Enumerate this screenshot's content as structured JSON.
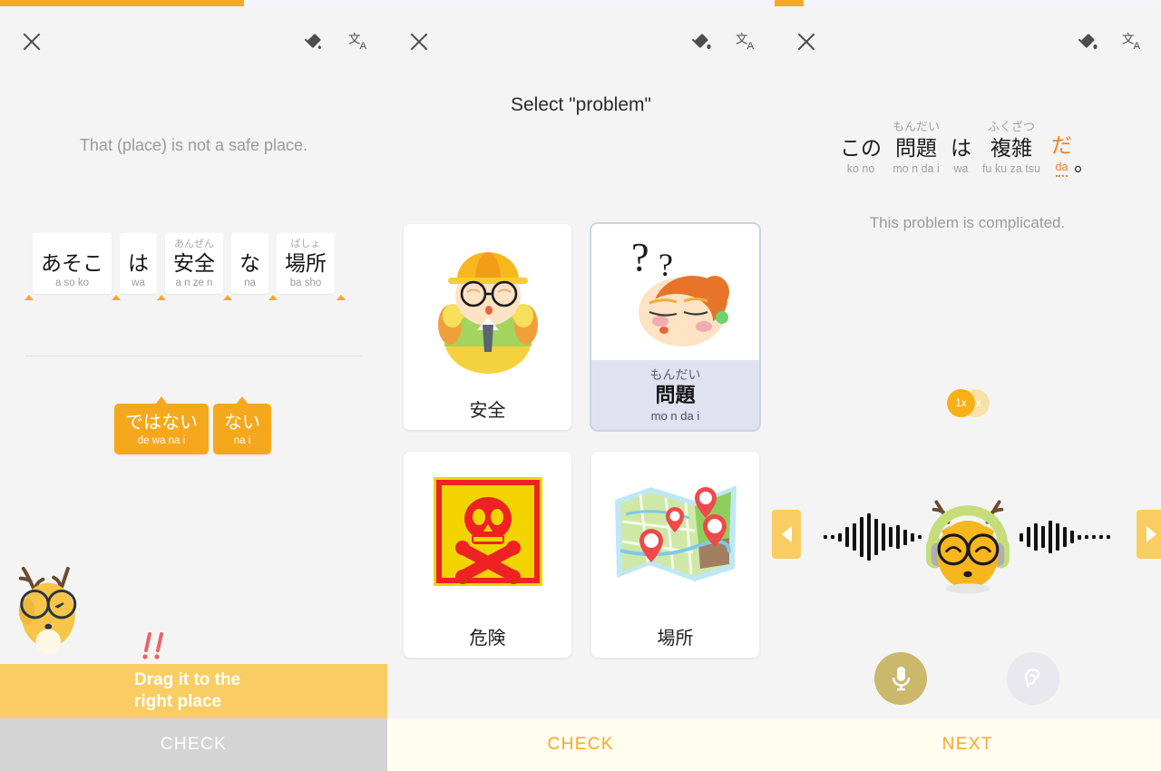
{
  "panels": {
    "left": {
      "progress_percent": 63,
      "close_label": "close-icon",
      "english_prompt": "That (place) is not a safe place.",
      "tiles": [
        {
          "furigana": "",
          "main": "あそこ",
          "romaji": "a so ko"
        },
        {
          "furigana": "",
          "main": "は",
          "romaji": "wa"
        },
        {
          "furigana": "あんぜん",
          "main": "安全",
          "romaji": "a n ze n"
        },
        {
          "furigana": "",
          "main": "な",
          "romaji": "na"
        },
        {
          "furigana": "ばしょ",
          "main": "場所",
          "romaji": "ba sho"
        }
      ],
      "answer_chips": [
        {
          "main": "ではない",
          "romaji": "de wa na i"
        },
        {
          "main": "ない",
          "romaji": "na i"
        }
      ],
      "hint_text": "Drag it to the\nright place",
      "hint_line1": "Drag it to the",
      "hint_line2": "right place",
      "check_label": "CHECK"
    },
    "middle": {
      "progress_percent": 0,
      "title": "Select \"problem\"",
      "cards": [
        {
          "label": "安全",
          "furigana": "",
          "romaji": "",
          "art": "safety-worker-image",
          "selected": false
        },
        {
          "label": "問題",
          "furigana": "もんだい",
          "romaji": "mo n da i",
          "art": "confused-person-image",
          "selected": true
        },
        {
          "label": "危険",
          "furigana": "",
          "romaji": "",
          "art": "danger-skull-sign-image",
          "selected": false
        },
        {
          "label": "場所",
          "furigana": "",
          "romaji": "",
          "art": "map-with-pins-image",
          "selected": false
        }
      ],
      "check_label": "CHECK"
    },
    "right": {
      "progress_percent": 7.5,
      "sentence_words": [
        {
          "furigana": "",
          "main": "この",
          "romaji": "ko no",
          "accent": false
        },
        {
          "furigana": "もんだい",
          "main": "問題",
          "romaji": "mo n da i",
          "accent": false
        },
        {
          "furigana": "",
          "main": "は",
          "romaji": "wa",
          "accent": false
        },
        {
          "furigana": "ふくざつ",
          "main": "複雑",
          "romaji": "fu ku za tsu",
          "accent": false
        },
        {
          "furigana": "",
          "main": "だ",
          "romaji": "da",
          "accent": true
        }
      ],
      "punctuation": "。",
      "english_translation": "This problem is complicated.",
      "speed": {
        "active": "1x",
        "alternate": "3x"
      },
      "prev_label": "prev-arrow-icon",
      "next_label": "next-arrow-icon",
      "mic_label": "microphone-icon",
      "ear_label": "ear-icon",
      "next_button_label": "NEXT"
    }
  },
  "toolbar": {
    "fill_icon": "paint-bucket-icon",
    "translate_icon": "translate-icon",
    "close_icon": "close-icon"
  },
  "colors": {
    "accent_orange": "#f9a825",
    "chip_orange": "#f5a81c",
    "hint_yellow": "#f9cd63",
    "selected_card": "#dfe3f0",
    "bottom_cream": "#fffdf0",
    "disabled_gray": "#d4d4d4"
  },
  "waveform": {
    "left_bars": [
      4,
      4,
      9,
      22,
      30,
      44,
      52,
      40,
      30,
      22,
      26,
      17,
      9,
      4
    ],
    "right_bars": [
      9,
      22,
      30,
      24,
      36,
      30,
      22,
      14,
      5,
      4,
      4,
      4,
      4
    ]
  }
}
